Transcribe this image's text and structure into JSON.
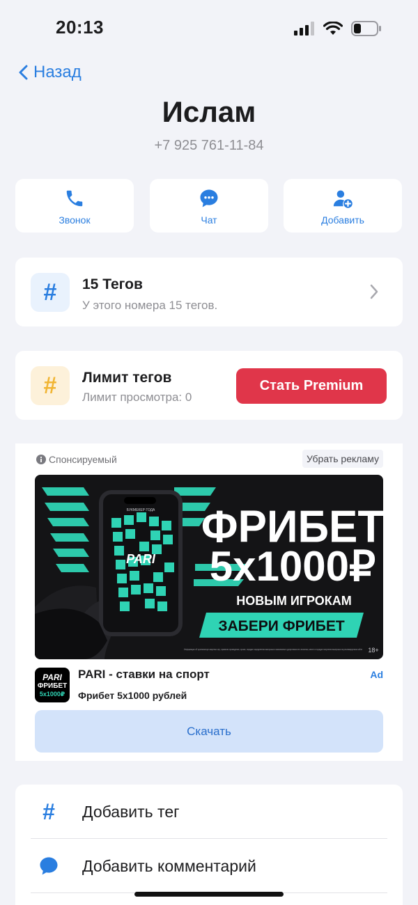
{
  "status_bar": {
    "time": "20:13",
    "icons": [
      "signal-icon",
      "wifi-icon",
      "battery-icon"
    ]
  },
  "nav": {
    "back_label": "Назад"
  },
  "contact": {
    "name": "Ислам",
    "phone": "+7 925 761-11-84"
  },
  "actions": [
    {
      "label": "Звонок",
      "icon": "phone-icon"
    },
    {
      "label": "Чат",
      "icon": "chat-icon"
    },
    {
      "label": "Добавить",
      "icon": "add-contact-icon"
    }
  ],
  "tags": {
    "title": "15 Тегов",
    "subtitle": "У этого номера 15 тегов.",
    "icon": "hashtag-icon"
  },
  "limit": {
    "title": "Лимит тегов",
    "subtitle": "Лимит просмотра: 0",
    "premium_label": "Стать Premium",
    "icon": "hashtag-icon"
  },
  "ad": {
    "sponsored_label": "Спонсируемый",
    "remove_label": "Убрать рекламу",
    "banner": {
      "brand": "PARI",
      "headline": "ФРИБЕТ",
      "amount": "5x1000₽",
      "subline": "НОВЫМ ИГРОКАМ",
      "cta": "ЗАБЕРИ ФРИБЕТ",
      "age": "18+",
      "phone_caption": "БУКМЕКЕР ГОДА",
      "disclaimer": "Информация об организаторе азартных игр, правилах проведения, сроках, порядке определения выигрыша и максимально допустимом его значении, месте и порядке получения выигрыша на рекламируемом сайте"
    },
    "app_logo": {
      "brand": "PARI",
      "line1": "ФРИБЕТ",
      "line2": "5x1000₽"
    },
    "app_name": "PARI - ставки на спорт",
    "app_description": "Фрибет 5x1000 рублей",
    "badge": "Ad",
    "download_label": "Скачать"
  },
  "menu": [
    {
      "label": "Добавить тег",
      "icon": "hashtag-icon"
    },
    {
      "label": "Добавить комментарий",
      "icon": "comment-icon"
    }
  ],
  "colors": {
    "accent": "#2a7ee0",
    "danger": "#e0364a",
    "tag_tile_blue": "#e9f2fd",
    "tag_tile_yellow": "#fdf1da",
    "yellow": "#f1b534",
    "banner_teal": "#2fd3b4"
  }
}
